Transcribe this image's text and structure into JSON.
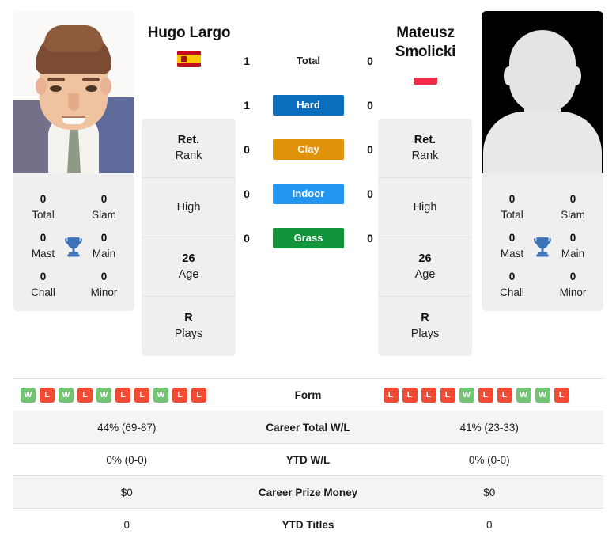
{
  "players": {
    "left": {
      "name": "Hugo Largo",
      "photo_caption": "Hugo Largo",
      "country_code": "ES",
      "flag_name": "spain-flag",
      "rank_value": "Ret.",
      "rank_label": "Rank",
      "high_value": "",
      "high_label": "High",
      "age_value": "26",
      "age_label": "Age",
      "plays_value": "R",
      "plays_label": "Plays",
      "titles": {
        "total": "0",
        "total_label": "Total",
        "slam": "0",
        "slam_label": "Slam",
        "mast": "0",
        "mast_label": "Mast",
        "main": "0",
        "main_label": "Main",
        "chall": "0",
        "chall_label": "Chall",
        "minor": "0",
        "minor_label": "Minor"
      },
      "surface_counts": {
        "total": "1",
        "hard": "1",
        "clay": "0",
        "indoor": "0",
        "grass": "0"
      },
      "form": [
        "W",
        "L",
        "W",
        "L",
        "W",
        "L",
        "L",
        "W",
        "L",
        "L"
      ],
      "career_total_wl": "44% (69-87)",
      "ytd_wl": "0% (0-0)",
      "career_prize_money": "$0",
      "ytd_titles": "0"
    },
    "right": {
      "name": "Mateusz Smolicki",
      "photo_caption": "Mateusz Smolicki",
      "country_code": "PL",
      "flag_name": "poland-flag",
      "rank_value": "Ret.",
      "rank_label": "Rank",
      "high_value": "",
      "high_label": "High",
      "age_value": "26",
      "age_label": "Age",
      "plays_value": "R",
      "plays_label": "Plays",
      "titles": {
        "total": "0",
        "total_label": "Total",
        "slam": "0",
        "slam_label": "Slam",
        "mast": "0",
        "mast_label": "Mast",
        "main": "0",
        "main_label": "Main",
        "chall": "0",
        "chall_label": "Chall",
        "minor": "0",
        "minor_label": "Minor"
      },
      "surface_counts": {
        "total": "0",
        "hard": "0",
        "clay": "0",
        "indoor": "0",
        "grass": "0"
      },
      "form": [
        "L",
        "L",
        "L",
        "L",
        "W",
        "L",
        "L",
        "W",
        "W",
        "L"
      ],
      "career_total_wl": "41% (23-33)",
      "ytd_wl": "0% (0-0)",
      "career_prize_money": "$0",
      "ytd_titles": "0"
    }
  },
  "surfaces": [
    {
      "label": "Total",
      "style": "plain",
      "color": "transparent"
    },
    {
      "label": "Hard",
      "style": "badge",
      "color": "#0b6ebd"
    },
    {
      "label": "Clay",
      "style": "badge",
      "color": "#e0920a"
    },
    {
      "label": "Indoor",
      "style": "badge",
      "color": "#2196f3"
    },
    {
      "label": "Grass",
      "style": "badge",
      "color": "#12953a"
    }
  ],
  "table_rows": [
    {
      "label": "Form"
    },
    {
      "label": "Career Total W/L"
    },
    {
      "label": "YTD W/L"
    },
    {
      "label": "Career Prize Money"
    },
    {
      "label": "YTD Titles"
    }
  ],
  "colors": {
    "win": "#74c476",
    "loss": "#ef4b35",
    "trophy": "#3b72b8",
    "panel": "#efefef",
    "row_shade": "#f4f4f4"
  }
}
